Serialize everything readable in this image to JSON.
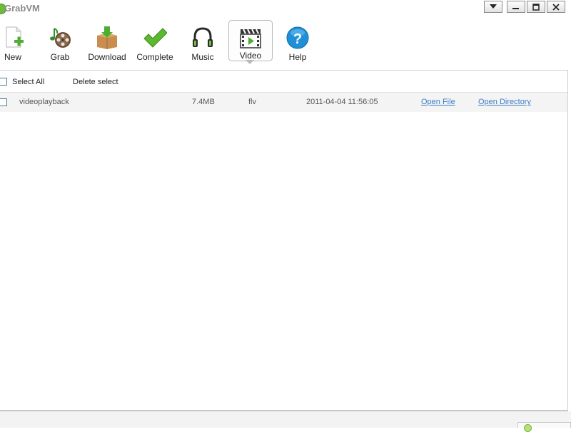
{
  "window": {
    "title": "GrabVM"
  },
  "toolbar": {
    "buttons": [
      {
        "label": "New",
        "icon": "new-document-icon"
      },
      {
        "label": "Grab",
        "icon": "grab-music-film-icon"
      },
      {
        "label": "Download",
        "icon": "download-box-icon"
      },
      {
        "label": "Complete",
        "icon": "checkmark-icon"
      },
      {
        "label": "Music",
        "icon": "headphones-icon"
      },
      {
        "label": "Video",
        "icon": "clapperboard-icon",
        "active": true
      },
      {
        "label": "Help",
        "icon": "help-icon"
      }
    ]
  },
  "actions": {
    "select_all": "Select All",
    "delete_select": "Delete select"
  },
  "files": [
    {
      "name": "videoplayback",
      "size": "7.4MB",
      "format": "flv",
      "date": "2011-04-04 11:56:05",
      "open_file": "Open File",
      "open_directory": "Open Directory"
    }
  ],
  "colors": {
    "accent_green": "#6dbb3a",
    "link_blue": "#3b7ec6",
    "help_blue": "#1f8fd8",
    "row_background": "#f4f4f4"
  }
}
